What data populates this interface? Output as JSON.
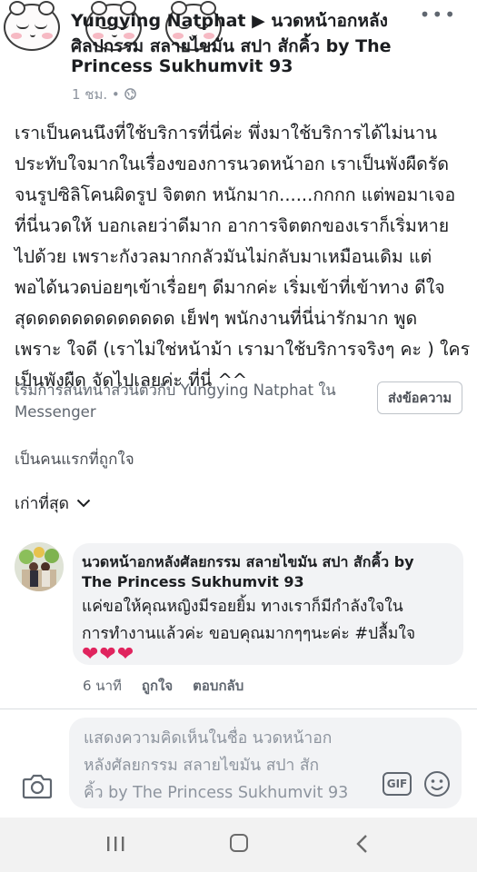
{
  "header": {
    "line1": "Yungying Natphat ▶ นวดหน้าอกหลัง",
    "line2": "ศิลปกรรม สลายไขมัน สปา สักคิ้ว by The",
    "line3": "Princess Sukhumvit 93",
    "time": "1 ชม. • ",
    "menu": "•••"
  },
  "post": {
    "lines": [
      "เราเป็นคนนึงที่ใช้บริการที่นี่ค่ะ พึ่งมาใช้บริการได้ไม่นาน",
      "ประทับใจมากในเรื่องของการนวดหน้าอก เราเป็นพังผืดรัด",
      "จนรูปซิลิโคนผิดรูป จิตตก หนักมาก......กกกก  แต่พอมาเจอ",
      "ที่นี่นวดให้ บอกเลยว่าดีมาก อาการจิตตกของเราก็เริ่มหาย",
      "ไปด้วย เพราะกังวลมากกลัวมันไม่กลับมาเหมือนเดิม แต่",
      "พอได้นวดบ่อยๆเข้าเรื่อยๆ ดีมากค่ะ เริ่มเข้าที่เข้าทาง ดีใจ",
      "สุดดดดดดดดดดดดด เย็ฟๆ พนักงานที่นี่น่ารักมาก พูด",
      "เพราะ ใจดี (เราไม่ใช่หน้าม้า เรามาใช้บริการจริงๆ คะ ) ใคร",
      "เป็นพังผืด จัดไปเลยค่ะ ที่นี่ ^^"
    ]
  },
  "messenger": {
    "line1": "เริ่มการสนทนาส่วนตัวกับ Yungying Natphat ใน",
    "line2": "Messenger",
    "send_label": "ส่งข้อความ"
  },
  "reactions": {
    "first_like": "เป็นคนแรกที่ถูกใจ"
  },
  "sort": {
    "label": "เก่าที่สุด"
  },
  "comment": {
    "name_line1": "นวดหน้าอกหลังศัลยกรรม สลายไขมัน สปา สักคิ้ว by",
    "name_line2": "The Princess Sukhumvit 93",
    "text_line1": "แค่ขอให้คุณหญิงมีรอยยิ้ม ทางเราก็มีกำลังใจใน",
    "text_line2": "การทำงานแล้วค่ะ ขอบคุณมากๆๆนะค่ะ #ปลื้มใจ",
    "hearts": "❤❤❤",
    "time": "6 นาที",
    "like": "ถูกใจ",
    "reply": "ตอบกลับ"
  },
  "composer": {
    "placeholder_line1": "แสดงความคิดเห็นในชื่อ นวดหน้าอก",
    "placeholder_line2": "หลังศัลยกรรม สลายไขมัน สปา สัก",
    "placeholder_line3": "คิ้ว by The Princess Sukhumvit 93",
    "gif_label": "GIF"
  },
  "colors": {
    "heart": "#e0245e",
    "bubble": "#f2f3f5",
    "muted_text": "#8d949e"
  }
}
